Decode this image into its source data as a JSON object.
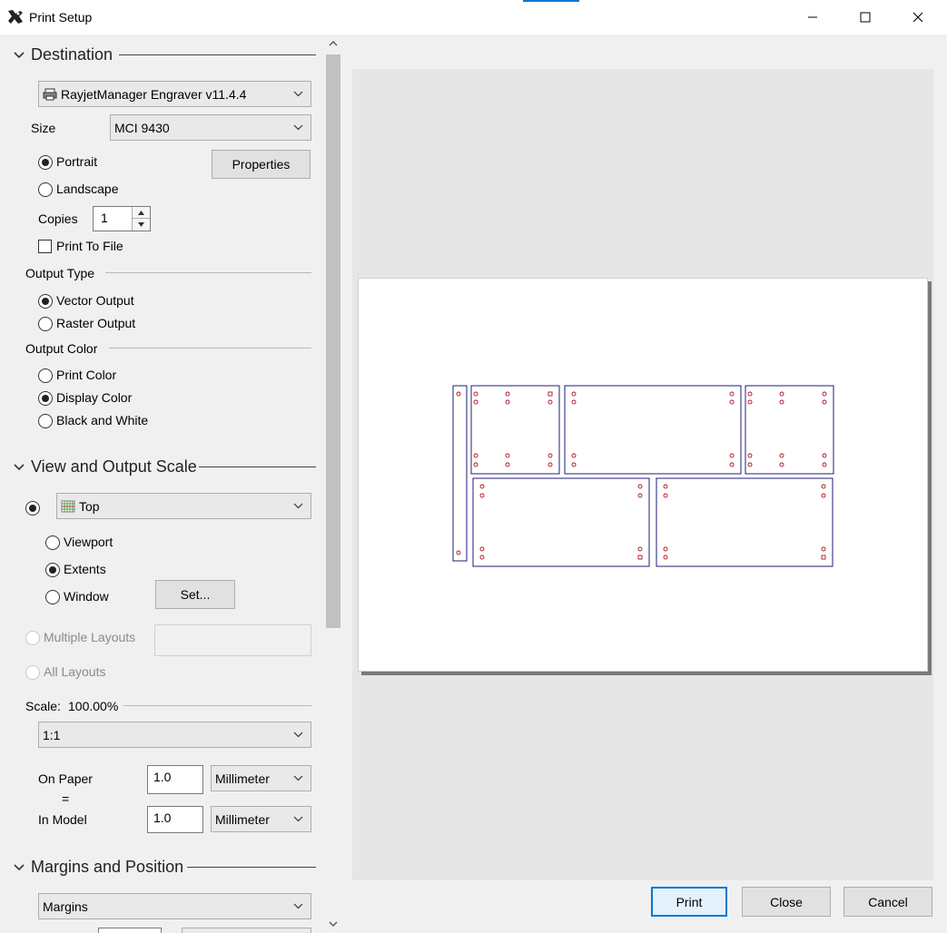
{
  "window": {
    "title": "Print Setup"
  },
  "destination": {
    "section_title": "Destination",
    "printer": "RayjetManager Engraver v11.4.4",
    "size_label": "Size",
    "size_value": "MCI 9430",
    "orientation": {
      "portrait": "Portrait",
      "landscape": "Landscape",
      "selected": "portrait"
    },
    "properties_button": "Properties",
    "copies_label": "Copies",
    "copies_value": "1",
    "print_to_file": "Print To File"
  },
  "output_type": {
    "title": "Output Type",
    "vector": "Vector Output",
    "raster": "Raster Output",
    "selected": "vector"
  },
  "output_color": {
    "title": "Output Color",
    "print": "Print Color",
    "display": "Display Color",
    "bw": "Black and White",
    "selected": "display"
  },
  "view_scale": {
    "section_title": "View and Output Scale",
    "view_value": "Top",
    "viewport": "Viewport",
    "extents": "Extents",
    "window": "Window",
    "set_button": "Set...",
    "multiple_layouts": "Multiple Layouts",
    "all_layouts": "All Layouts",
    "scale_label": "Scale:",
    "scale_value": "100.00%",
    "ratio_value": "1:1",
    "on_paper_label": "On Paper",
    "equals": "=",
    "in_model_label": "In Model",
    "on_paper_value": "1.0",
    "in_model_value": "1.0",
    "on_paper_unit": "Millimeter",
    "in_model_unit": "Millimeter"
  },
  "margins": {
    "section_title": "Margins and Position",
    "margins_value": "Margins"
  },
  "buttons": {
    "print": "Print",
    "close": "Close",
    "cancel": "Cancel"
  },
  "colors": {
    "accent": "#0078d7",
    "drawing_outline": "#1c1c7a",
    "drawing_holes": "#b01020"
  }
}
